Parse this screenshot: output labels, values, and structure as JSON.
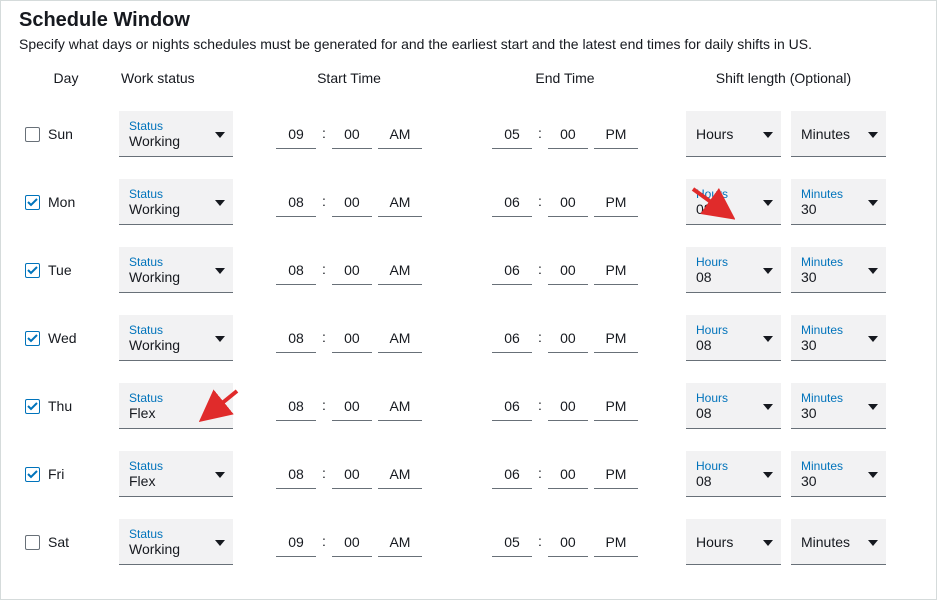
{
  "panel": {
    "title": "Schedule Window",
    "description": "Specify what days or nights schedules must be generated for and the earliest start and the latest end times for daily shifts in US."
  },
  "columns": {
    "day": "Day",
    "status": "Work status",
    "start": "Start Time",
    "end": "End Time",
    "shift": "Shift length (Optional)"
  },
  "labels": {
    "status": "Status",
    "hours": "Hours",
    "minutes": "Minutes",
    "colon": ":"
  },
  "days": [
    {
      "id": "sun",
      "name": "Sun",
      "checked": false,
      "status": "Working",
      "start": {
        "h": "09",
        "m": "00",
        "p": "AM"
      },
      "end": {
        "h": "05",
        "m": "00",
        "p": "PM"
      },
      "shift": {
        "hours": "",
        "minutes": ""
      }
    },
    {
      "id": "mon",
      "name": "Mon",
      "checked": true,
      "status": "Working",
      "start": {
        "h": "08",
        "m": "00",
        "p": "AM"
      },
      "end": {
        "h": "06",
        "m": "00",
        "p": "PM"
      },
      "shift": {
        "hours": "08",
        "minutes": "30"
      }
    },
    {
      "id": "tue",
      "name": "Tue",
      "checked": true,
      "status": "Working",
      "start": {
        "h": "08",
        "m": "00",
        "p": "AM"
      },
      "end": {
        "h": "06",
        "m": "00",
        "p": "PM"
      },
      "shift": {
        "hours": "08",
        "minutes": "30"
      }
    },
    {
      "id": "wed",
      "name": "Wed",
      "checked": true,
      "status": "Working",
      "start": {
        "h": "08",
        "m": "00",
        "p": "AM"
      },
      "end": {
        "h": "06",
        "m": "00",
        "p": "PM"
      },
      "shift": {
        "hours": "08",
        "minutes": "30"
      }
    },
    {
      "id": "thu",
      "name": "Thu",
      "checked": true,
      "status": "Flex",
      "start": {
        "h": "08",
        "m": "00",
        "p": "AM"
      },
      "end": {
        "h": "06",
        "m": "00",
        "p": "PM"
      },
      "shift": {
        "hours": "08",
        "minutes": "30"
      }
    },
    {
      "id": "fri",
      "name": "Fri",
      "checked": true,
      "status": "Flex",
      "start": {
        "h": "08",
        "m": "00",
        "p": "AM"
      },
      "end": {
        "h": "06",
        "m": "00",
        "p": "PM"
      },
      "shift": {
        "hours": "08",
        "minutes": "30"
      }
    },
    {
      "id": "sat",
      "name": "Sat",
      "checked": false,
      "status": "Working",
      "start": {
        "h": "09",
        "m": "00",
        "p": "AM"
      },
      "end": {
        "h": "05",
        "m": "00",
        "p": "PM"
      },
      "shift": {
        "hours": "",
        "minutes": ""
      }
    }
  ],
  "annotations": {
    "arrow_color": "#e02b2b"
  }
}
